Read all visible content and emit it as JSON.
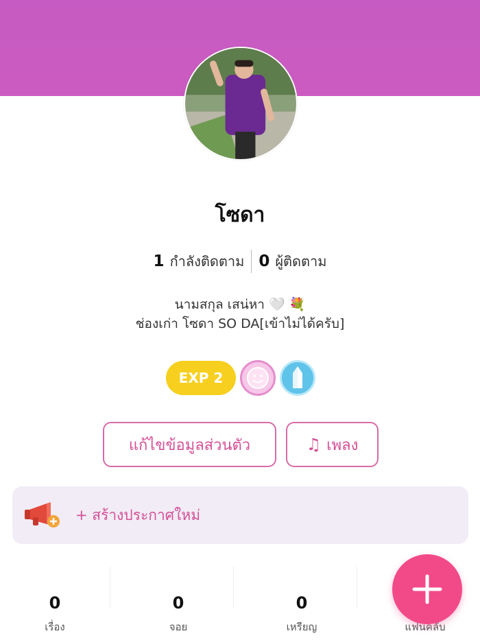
{
  "profile": {
    "name": "โซดา",
    "following_count": "1",
    "following_label": "กำลังติดตาม",
    "followers_count": "0",
    "followers_label": "ผู้ติดตาม",
    "bio_line1": "นามสกุล เสน่หา 🤍 💐",
    "bio_line2": "ช่องเก่า โซดา SO DA[เข้าไม่ได้ครับ]"
  },
  "badges": {
    "exp_label": "EXP 2",
    "icons": [
      "smiley-badge-icon",
      "crystal-badge-icon"
    ]
  },
  "actions": {
    "edit_profile_label": "แก้ไขข้อมูลส่วนตัว",
    "music_label": "เพลง",
    "music_icon": "music-note-icon"
  },
  "announcement": {
    "label": "+ สร้างประกาศใหม่",
    "icon": "megaphone-icon"
  },
  "counters": [
    {
      "value": "0",
      "label": "เรื่อง"
    },
    {
      "value": "0",
      "label": "จอย"
    },
    {
      "value": "0",
      "label": "เหรียญ"
    },
    {
      "value": "",
      "label": "แฟนคลับ"
    }
  ],
  "colors": {
    "header": "#c95bc2",
    "accent_pink": "#d45096",
    "fab": "#f24a89",
    "exp_badge": "#f7cf1e",
    "announce_bg": "#f1ecf6"
  }
}
